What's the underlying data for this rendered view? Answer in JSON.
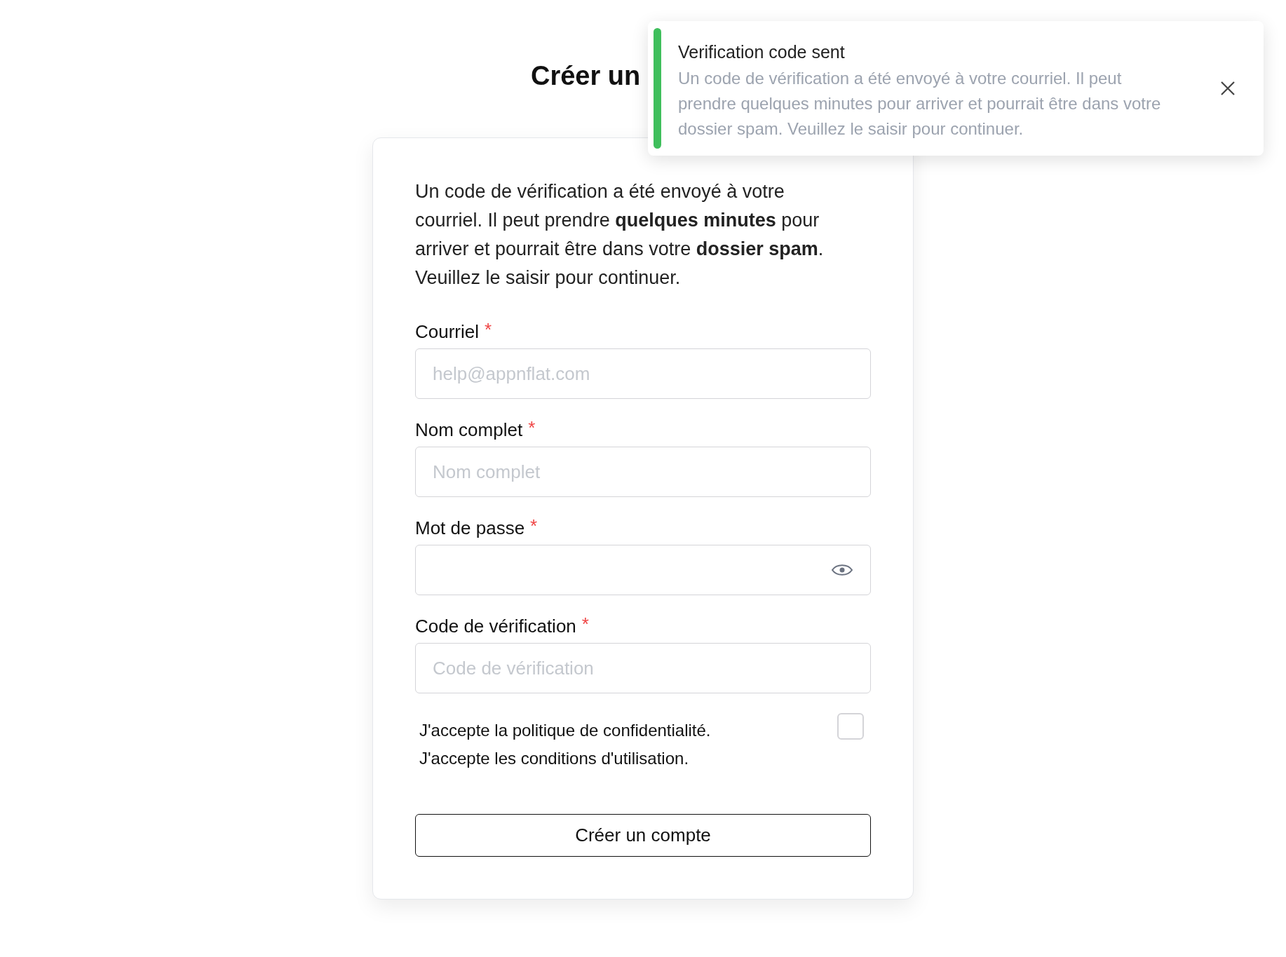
{
  "page": {
    "title": "Créer un"
  },
  "toast": {
    "title": "Verification code sent",
    "message": "Un code de vérification a été envoyé à votre courriel. Il peut prendre quelques minutes pour arriver et pourrait être dans votre dossier spam. Veuillez le saisir pour continuer.",
    "color": "#3fbf5c"
  },
  "form": {
    "intro": "Un code de vérification a été envoyé à votre courriel. Il peut prendre **quelques minutes** pour arriver et pourrait être dans votre **dossier spam**. Veuillez le saisir pour continuer.",
    "fields": [
      {
        "label": "Courriel",
        "required_mark": "*",
        "placeholder": "help@appnflat.com",
        "kind": "text"
      },
      {
        "label": "Nom complet",
        "required_mark": "*",
        "placeholder": "Nom complet",
        "kind": "text"
      },
      {
        "label": "Mot de passe",
        "required_mark": "*",
        "kind": "password"
      },
      {
        "label": "Code de vérification",
        "required_mark": "*",
        "placeholder": "Code de vérification",
        "kind": "text"
      }
    ],
    "agreement": {
      "lines": [
        "J'accepte la politique de confidentialité.",
        "J'accepte les conditions d'utilisation."
      ],
      "checked": false
    },
    "submit": "Créer un compte"
  }
}
